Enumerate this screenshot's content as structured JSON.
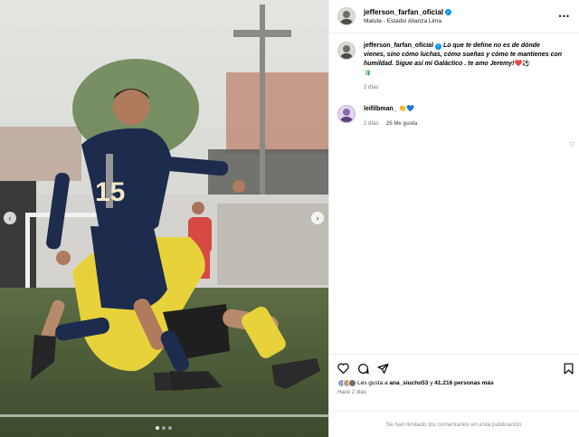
{
  "post": {
    "author": "jefferson_farfan_oficial",
    "location": "Matute - Estadio Alianza Lima"
  },
  "caption": {
    "author": "jefferson_farfan_oficial",
    "text": "Lo que te define no es de dónde vienes, sino cómo luchas, cómo sueñas y cómo te mantienes con humildad. Sigue así mi Galáctico . te amo Jeremy!",
    "emoji_tail": "❤️⚽",
    "emoji_end": "🧃",
    "time": "2 días"
  },
  "comment": {
    "author": "leifilbman_",
    "emojis": "👏💙",
    "time": "2 días",
    "likes": "25 Me gusta"
  },
  "likes": {
    "prefix": "Les gusta a",
    "user": "ana_siucho53",
    "middle": "y",
    "count": "41.216 personas más"
  },
  "posted_ago": "Hace 2 días",
  "comments_limited": "Se han limitado los comentarios en esta publicación.",
  "media": {
    "jersey_number": "15",
    "prev_icon": "chevron-left-icon",
    "next_icon": "chevron-right-icon",
    "slide_count": 3,
    "active_slide": 1
  },
  "colors": {
    "verified": "#0095f6",
    "heart": "#ed4956",
    "secondary_text": "#737373"
  }
}
